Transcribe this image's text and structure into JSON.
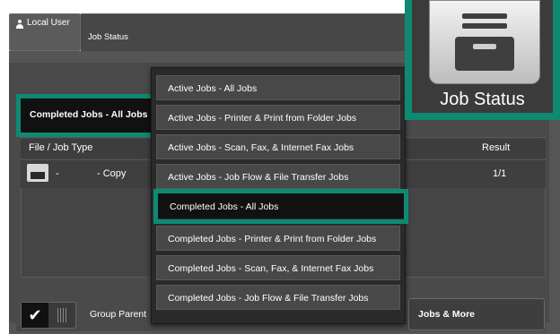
{
  "header": {
    "user_label": "Local User",
    "title": "Job Status"
  },
  "filter": {
    "selected": "Completed Jobs - All Jobs"
  },
  "table": {
    "columns": [
      "File / Job Type",
      "Result"
    ],
    "rows": [
      {
        "dash": "-",
        "type": "- Copy",
        "result": "1/1"
      }
    ]
  },
  "footer": {
    "group_label": "Group Parent",
    "more_label": "Jobs & More"
  },
  "menu": {
    "items": [
      "Active Jobs - All Jobs",
      "Active Jobs - Printer & Print from Folder Jobs",
      "Active Jobs - Scan, Fax, & Internet Fax Jobs",
      "Active Jobs - Job Flow & File Transfer Jobs",
      "Completed Jobs - All Jobs",
      "Completed Jobs - Printer & Print from Folder Jobs",
      "Completed Jobs - Scan, Fax, & Internet Fax Jobs",
      "Completed Jobs - Job Flow & File Transfer Jobs"
    ],
    "selected_index": 4
  },
  "tile": {
    "label": "Job Status",
    "icon": "job-status-tray-icon"
  },
  "colors": {
    "highlight": "#0e8a73",
    "panel": "#555555",
    "selected": "#111111"
  }
}
